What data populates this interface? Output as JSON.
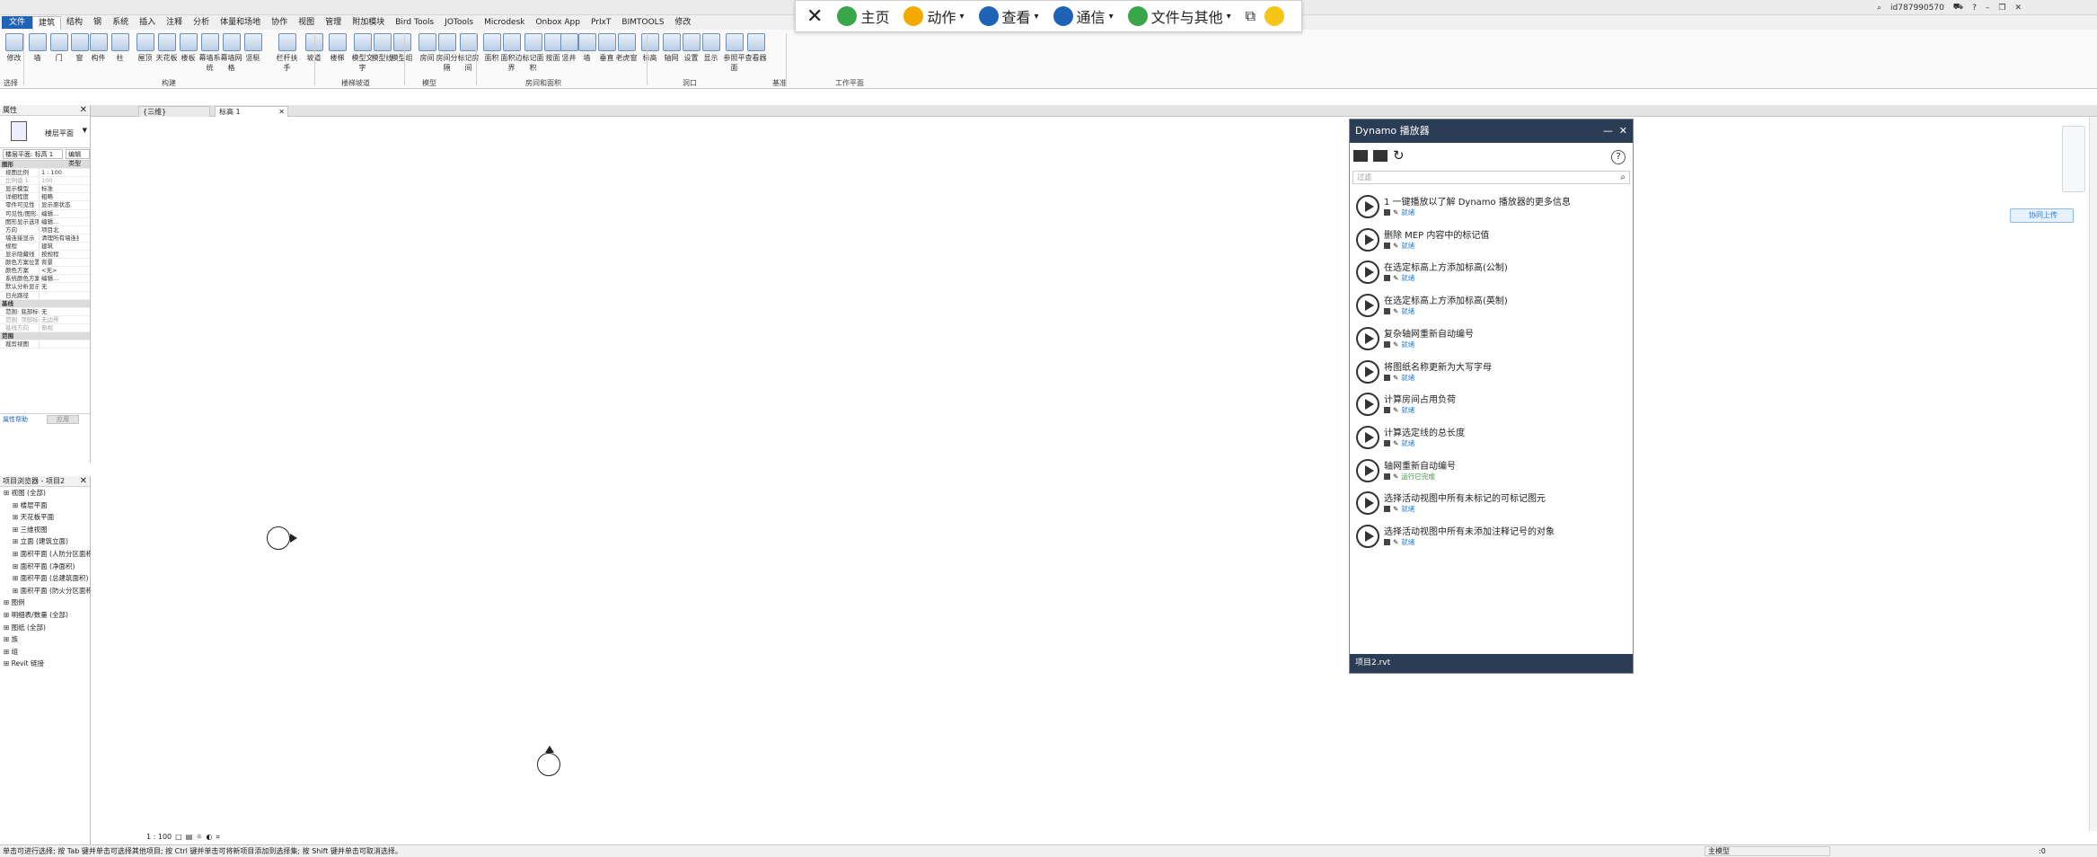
{
  "menu": {
    "tabs": [
      "文件",
      "建筑",
      "结构",
      "钢",
      "系统",
      "插入",
      "注释",
      "分析",
      "体量和场地",
      "协作",
      "视图",
      "管理",
      "附加模块",
      "Bird Tools",
      "JOTools",
      "Microdesk",
      "Onbox App",
      "PrIxT",
      "BIMTOOLS",
      "修改"
    ]
  },
  "float_toolbar": {
    "items": [
      {
        "label": "主页",
        "icon": "home-icon"
      },
      {
        "label": "动作",
        "icon": "lightning-icon"
      },
      {
        "label": "查看",
        "icon": "monitor-icon"
      },
      {
        "label": "通信",
        "icon": "phone-icon"
      },
      {
        "label": "文件与其他",
        "icon": "file-transfer-icon"
      }
    ]
  },
  "user": {
    "id": "id787990570"
  },
  "ribbon": {
    "buttons": [
      "修改",
      "墙",
      "门",
      "窗",
      "构件",
      "柱",
      "屋顶",
      "天花板",
      "楼板",
      "幕墙系统",
      "幕墙网格",
      "竖梃",
      "栏杆扶手",
      "坡道",
      "楼梯",
      "模型文字",
      "模型线",
      "模型组",
      "房间",
      "房间分隔",
      "标记房间",
      "面积",
      "面积边界",
      "标记面积",
      "按面",
      "竖井",
      "墙",
      "垂直",
      "老虎窗",
      "标高",
      "轴网",
      "设置",
      "显示",
      "参照平面",
      "查看器"
    ],
    "panels": [
      "选择",
      "构建",
      "楼梯坡道",
      "模型",
      "房间和面积",
      "洞口",
      "基准",
      "工作平面"
    ]
  },
  "properties": {
    "title": "属性",
    "type_name": "楼层平面",
    "selector": "楼层平面: 标高 1",
    "edit_type": "编辑类型",
    "rows": [
      {
        "k": "图形",
        "v": "",
        "grp": true
      },
      {
        "k": "视图比例",
        "v": "1 : 100"
      },
      {
        "k": "比例值 1:",
        "v": "100",
        "dis": true
      },
      {
        "k": "显示模型",
        "v": "标准"
      },
      {
        "k": "详细程度",
        "v": "粗略"
      },
      {
        "k": "零件可见性",
        "v": "显示原状态"
      },
      {
        "k": "可见性/图形...",
        "v": "编辑..."
      },
      {
        "k": "图形显示选项",
        "v": "编辑..."
      },
      {
        "k": "方向",
        "v": "项目北"
      },
      {
        "k": "墙连接显示",
        "v": "清理所有墙连接"
      },
      {
        "k": "规程",
        "v": "建筑"
      },
      {
        "k": "显示隐藏线",
        "v": "按规程"
      },
      {
        "k": "颜色方案位置",
        "v": "背景"
      },
      {
        "k": "颜色方案",
        "v": "<无>"
      },
      {
        "k": "系统颜色方案",
        "v": "编辑..."
      },
      {
        "k": "默认分析显示...",
        "v": "无"
      },
      {
        "k": "日光路径",
        "v": ""
      },
      {
        "k": "基线",
        "v": "",
        "grp": true
      },
      {
        "k": "范围: 底部标高",
        "v": "无"
      },
      {
        "k": "范围: 顶部标高",
        "v": "无边界",
        "dis": true
      },
      {
        "k": "基线方向",
        "v": "俯视",
        "dis": true
      },
      {
        "k": "范围",
        "v": "",
        "grp": true
      },
      {
        "k": "裁剪视图",
        "v": ""
      }
    ],
    "help": "属性帮助",
    "apply": "应用"
  },
  "browser": {
    "title": "项目浏览器 - 项目2",
    "items": [
      {
        "t": "视图 (全部)",
        "lvl": 0
      },
      {
        "t": "楼层平面",
        "lvl": 1
      },
      {
        "t": "天花板平面",
        "lvl": 1
      },
      {
        "t": "三维视图",
        "lvl": 1
      },
      {
        "t": "立面 (建筑立面)",
        "lvl": 1
      },
      {
        "t": "面积平面 (人防分区面积)",
        "lvl": 1
      },
      {
        "t": "面积平面 (净面积)",
        "lvl": 1
      },
      {
        "t": "面积平面 (总建筑面积)",
        "lvl": 1
      },
      {
        "t": "面积平面 (防火分区面积)",
        "lvl": 1
      },
      {
        "t": "图例",
        "lvl": 0
      },
      {
        "t": "明细表/数量 (全部)",
        "lvl": 0
      },
      {
        "t": "图纸 (全部)",
        "lvl": 0
      },
      {
        "t": "族",
        "lvl": 0
      },
      {
        "t": "组",
        "lvl": 0
      },
      {
        "t": "Revit 链接",
        "lvl": 0
      }
    ]
  },
  "doc_tabs": [
    "{三维}",
    "标高 1"
  ],
  "dynamo": {
    "title": "Dynamo 播放器",
    "search_placeholder": "过滤",
    "footer": "项目2.rvt",
    "scripts": [
      {
        "name": "1 一键播放以了解 Dynamo 播放器的更多信息",
        "status": "就绪",
        "ok": false
      },
      {
        "name": "删除 MEP 内容中的标记值",
        "status": "就绪",
        "ok": false
      },
      {
        "name": "在选定标高上方添加标高(公制)",
        "status": "就绪",
        "ok": false
      },
      {
        "name": "在选定标高上方添加标高(英制)",
        "status": "就绪",
        "ok": false
      },
      {
        "name": "复杂轴网重新自动编号",
        "status": "就绪",
        "ok": false
      },
      {
        "name": "将图纸名称更新为大写字母",
        "status": "就绪",
        "ok": false
      },
      {
        "name": "计算房间占用负荷",
        "status": "就绪",
        "ok": false
      },
      {
        "name": "计算选定线的总长度",
        "status": "就绪",
        "ok": false
      },
      {
        "name": "轴网重新自动编号",
        "status": "运行已完成",
        "ok": true
      },
      {
        "name": "选择活动视图中所有未标记的可标记图元",
        "status": "就绪",
        "ok": false
      },
      {
        "name": "选择活动视图中所有未添加注释记号的对象",
        "status": "就绪",
        "ok": false
      }
    ]
  },
  "share_button": "协同上传",
  "view_scale": "1 : 100",
  "status_text": "单击可进行选择; 按 Tab 键并单击可选择其他项目; 按 Ctrl 键并单击可将新项目添加到选择集; 按 Shift 键并单击可取消选择。",
  "status_model": "主模型",
  "status_zero": ":0",
  "colors": {
    "accent": "#1e63b5",
    "dynamo_header": "#2b3d55",
    "ok_status": "#2e9b2e",
    "ready_status": "#1e7fd6"
  }
}
